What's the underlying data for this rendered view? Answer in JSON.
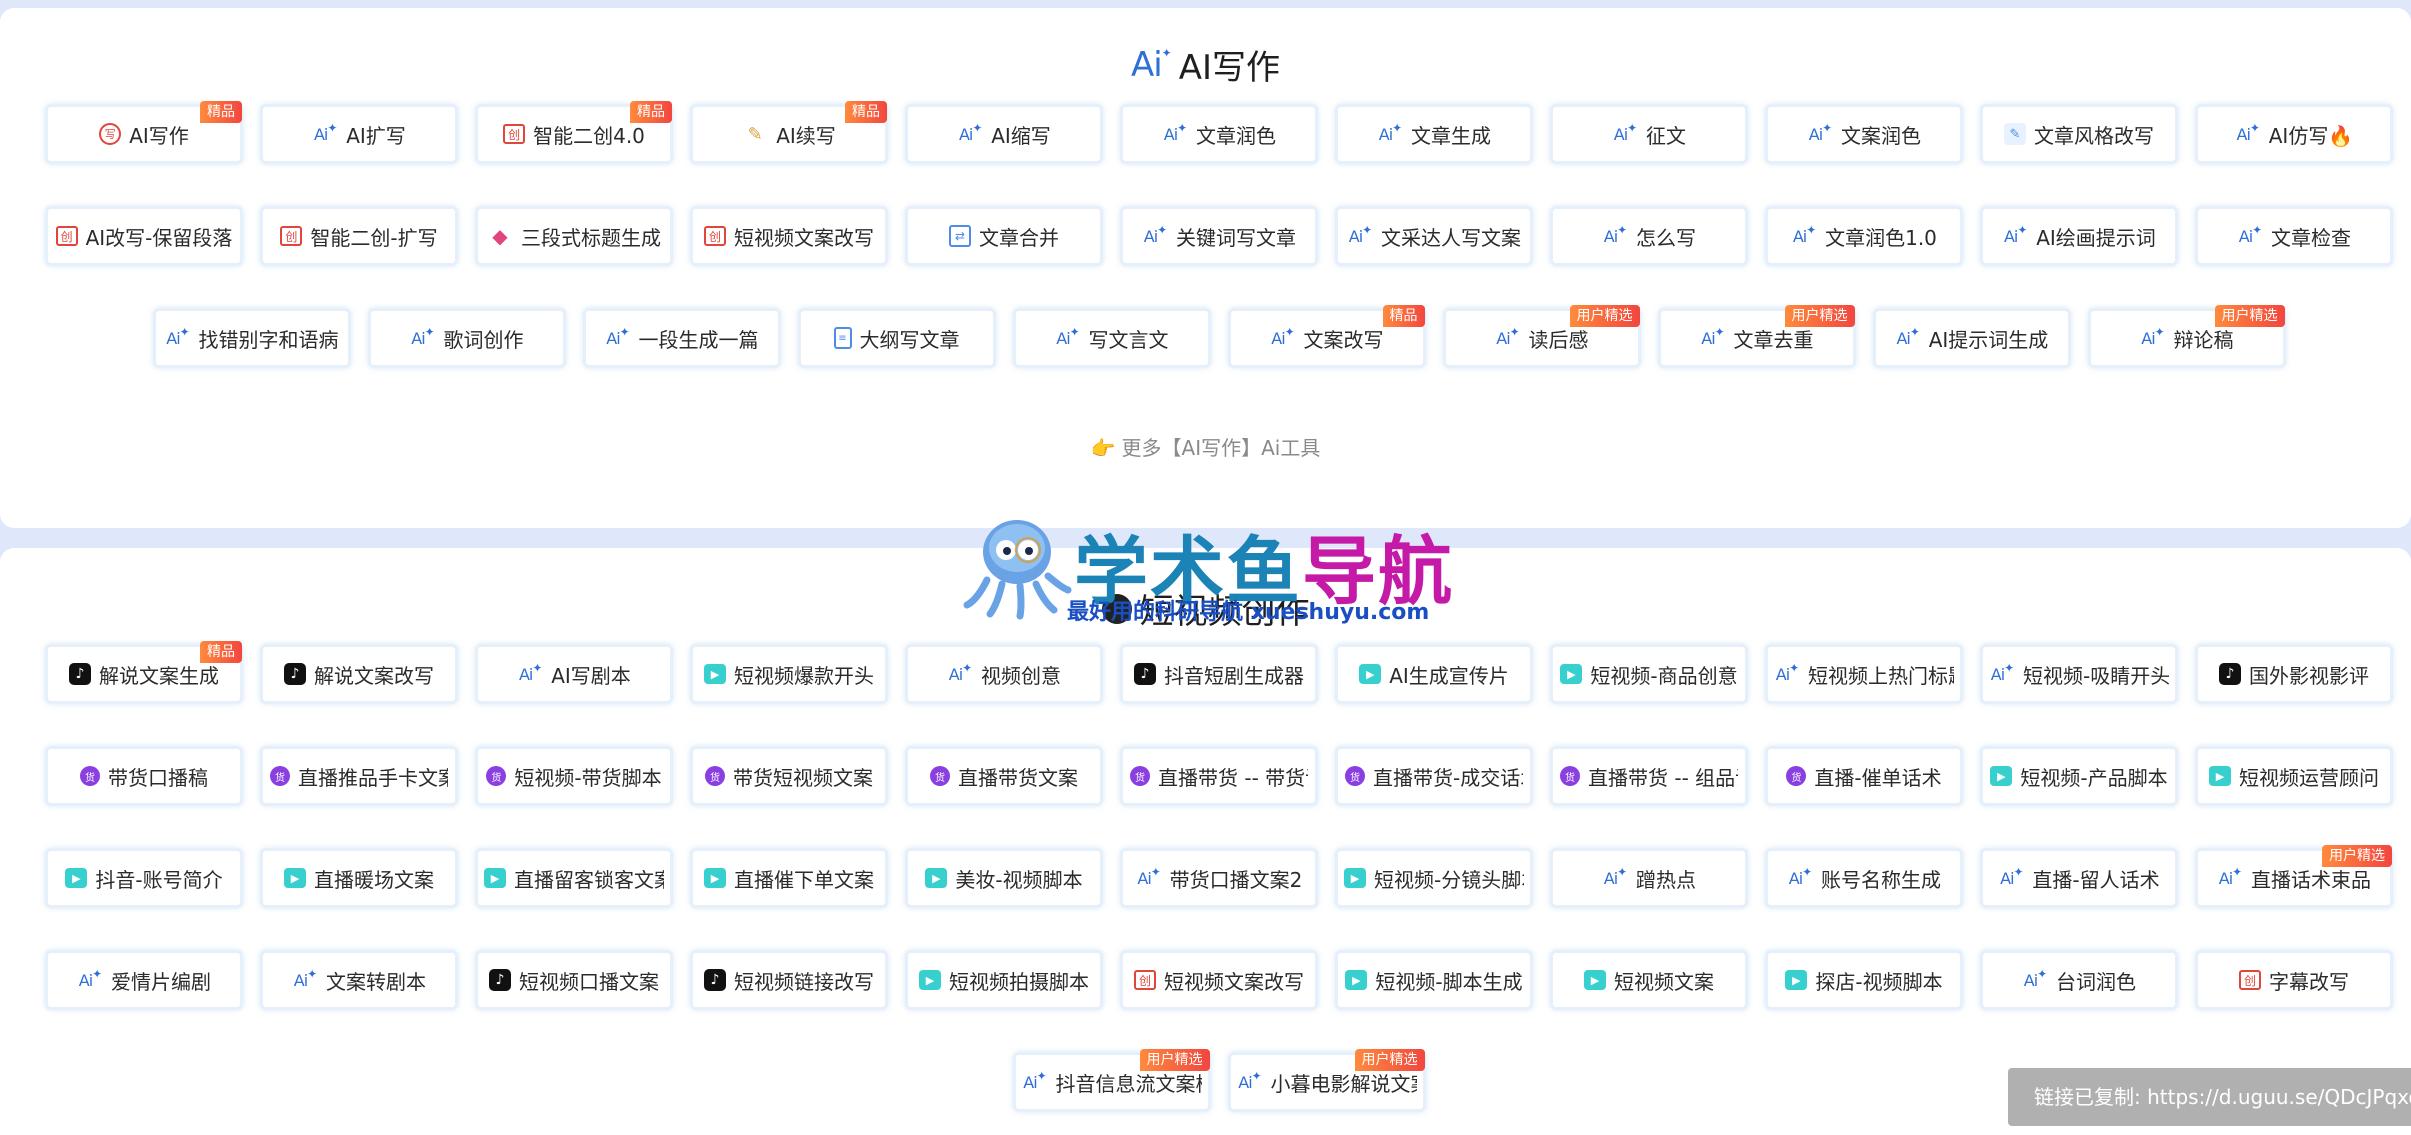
{
  "writing_section": {
    "title": "AI写作",
    "more_link": "更多【AI写作】Ai工具",
    "rows": [
      [
        {
          "label": "AI写作",
          "icon": "seal-icon",
          "badge": "精品"
        },
        {
          "label": "AI扩写",
          "icon": "ai-icon"
        },
        {
          "label": "智能二创4.0",
          "icon": "stamp-icon",
          "badge": "精品"
        },
        {
          "label": "AI续写",
          "icon": "pen-icon",
          "badge": "精品"
        },
        {
          "label": "AI缩写",
          "icon": "ai-icon"
        },
        {
          "label": "文章润色",
          "icon": "ai-icon"
        },
        {
          "label": "文章生成",
          "icon": "ai-icon"
        },
        {
          "label": "征文",
          "icon": "ai-icon"
        },
        {
          "label": "文案润色",
          "icon": "ai-icon"
        },
        {
          "label": "文章风格改写",
          "icon": "edit-icon"
        },
        {
          "label": "AI仿写🔥",
          "icon": "ai-icon"
        }
      ],
      [
        {
          "label": "AI改写-保留段落",
          "icon": "stamp-icon"
        },
        {
          "label": "智能二创-扩写",
          "icon": "stamp-icon"
        },
        {
          "label": "三段式标题生成",
          "icon": "tag-icon"
        },
        {
          "label": "短视频文案改写",
          "icon": "stamp-icon"
        },
        {
          "label": "文章合并",
          "icon": "merge-icon"
        },
        {
          "label": "关键词写文章",
          "icon": "ai-icon"
        },
        {
          "label": "文采达人写文案",
          "icon": "ai-icon"
        },
        {
          "label": "怎么写",
          "icon": "ai-icon"
        },
        {
          "label": "文章润色1.0",
          "icon": "ai-icon"
        },
        {
          "label": "AI绘画提示词",
          "icon": "ai-icon"
        },
        {
          "label": "文章检查",
          "icon": "ai-icon"
        }
      ],
      [
        {
          "label": "找错别字和语病",
          "icon": "ai-icon"
        },
        {
          "label": "歌词创作",
          "icon": "ai-icon"
        },
        {
          "label": "一段生成一篇",
          "icon": "ai-icon"
        },
        {
          "label": "大纲写文章",
          "icon": "doc-icon"
        },
        {
          "label": "写文言文",
          "icon": "ai-icon"
        },
        {
          "label": "文案改写",
          "icon": "ai-icon",
          "badge": "精品"
        },
        {
          "label": "读后感",
          "icon": "ai-icon",
          "badge": "用户精选"
        },
        {
          "label": "文章去重",
          "icon": "ai-icon",
          "badge": "用户精选"
        },
        {
          "label": "AI提示词生成",
          "icon": "ai-icon"
        },
        {
          "label": "辩论稿",
          "icon": "ai-icon",
          "badge": "用户精选"
        }
      ]
    ]
  },
  "video_section": {
    "title": "短视频创作",
    "rows": [
      [
        {
          "label": "解说文案生成",
          "icon": "tiktok-icon",
          "badge": "精品"
        },
        {
          "label": "解说文案改写",
          "icon": "tiktok-icon"
        },
        {
          "label": "AI写剧本",
          "icon": "ai-icon"
        },
        {
          "label": "短视频爆款开头",
          "icon": "clapper-icon"
        },
        {
          "label": "视频创意",
          "icon": "ai-icon"
        },
        {
          "label": "抖音短剧生成器",
          "icon": "tiktok-icon"
        },
        {
          "label": "AI生成宣传片",
          "icon": "clapper-icon"
        },
        {
          "label": "短视频-商品创意",
          "icon": "clapper-icon"
        },
        {
          "label": "短视频上热门标题",
          "icon": "ai-icon"
        },
        {
          "label": "短视频-吸睛开头",
          "icon": "ai-icon"
        },
        {
          "label": "国外影视影评",
          "icon": "tiktok-icon"
        }
      ],
      [
        {
          "label": "带货口播稿",
          "icon": "goods-icon"
        },
        {
          "label": "直播推品手卡文案",
          "icon": "goods-icon"
        },
        {
          "label": "短视频-带货脚本",
          "icon": "goods-icon"
        },
        {
          "label": "带货短视频文案",
          "icon": "goods-icon"
        },
        {
          "label": "直播带货文案",
          "icon": "goods-icon"
        },
        {
          "label": "直播带货 -- 带货话术",
          "icon": "goods-icon"
        },
        {
          "label": "直播带货-成交话术",
          "icon": "goods-icon"
        },
        {
          "label": "直播带货 -- 组品话术",
          "icon": "goods-icon"
        },
        {
          "label": "直播-催单话术",
          "icon": "goods-icon"
        },
        {
          "label": "短视频-产品脚本",
          "icon": "clapper-icon"
        },
        {
          "label": "短视频运营顾问",
          "icon": "clapper-icon"
        }
      ],
      [
        {
          "label": "抖音-账号简介",
          "icon": "clapper-icon"
        },
        {
          "label": "直播暖场文案",
          "icon": "clapper-icon"
        },
        {
          "label": "直播留客锁客文案",
          "icon": "clapper-icon"
        },
        {
          "label": "直播催下单文案",
          "icon": "clapper-icon"
        },
        {
          "label": "美妆-视频脚本",
          "icon": "clapper-icon"
        },
        {
          "label": "带货口播文案2",
          "icon": "ai-icon"
        },
        {
          "label": "短视频-分镜头脚本",
          "icon": "clapper-icon"
        },
        {
          "label": "蹭热点",
          "icon": "ai-icon"
        },
        {
          "label": "账号名称生成",
          "icon": "ai-icon"
        },
        {
          "label": "直播-留人话术",
          "icon": "ai-icon"
        },
        {
          "label": "直播话术束品",
          "icon": "ai-icon",
          "badge": "用户精选"
        }
      ],
      [
        {
          "label": "爱情片编剧",
          "icon": "ai-icon"
        },
        {
          "label": "文案转剧本",
          "icon": "ai-icon"
        },
        {
          "label": "短视频口播文案",
          "icon": "tiktok-icon"
        },
        {
          "label": "短视频链接改写",
          "icon": "tiktok-icon"
        },
        {
          "label": "短视频拍摄脚本",
          "icon": "clapper-icon"
        },
        {
          "label": "短视频文案改写",
          "icon": "stamp-icon"
        },
        {
          "label": "短视频-脚本生成",
          "icon": "clapper-icon"
        },
        {
          "label": "短视频文案",
          "icon": "clapper-icon"
        },
        {
          "label": "探店-视频脚本",
          "icon": "clapper-icon"
        },
        {
          "label": "台词润色",
          "icon": "ai-icon"
        },
        {
          "label": "字幕改写",
          "icon": "stamp-icon"
        }
      ],
      [
        {
          "label": "抖音信息流文案模板",
          "icon": "ai-icon",
          "badge": "用户精选"
        },
        {
          "label": "小暮电影解说文案",
          "icon": "ai-icon",
          "badge": "用户精选"
        }
      ]
    ]
  },
  "watermark": {
    "title_part1": "学术鱼",
    "title_part2": "导航",
    "subtitle": "最好用的科研导航 xueshuyu.com"
  },
  "toast": {
    "text": "链接已复制: https://d.uguu.se/QDcJPqxo.",
    "color": "#ffffff"
  },
  "colors": {
    "badge": "#f2463f",
    "ai_blue": "#2f6fd6",
    "page_bg": "#dfe7fb"
  }
}
